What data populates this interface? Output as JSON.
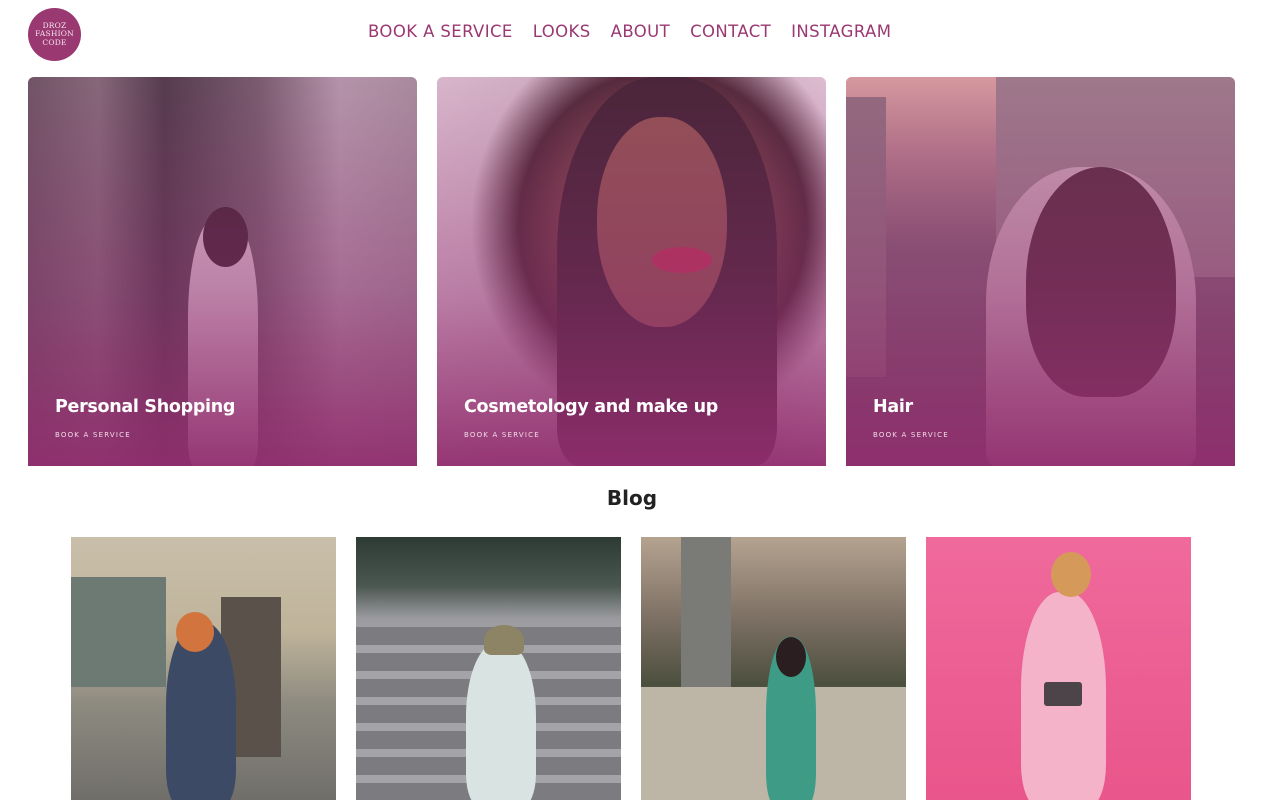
{
  "header": {
    "logo_lines": [
      "DROZ",
      "FASHION",
      "CODE"
    ],
    "nav": [
      "BOOK A SERVICE",
      "LOOKS",
      "ABOUT",
      "CONTACT",
      "INSTAGRAM"
    ]
  },
  "services": [
    {
      "title": "Personal Shopping",
      "cta": "BOOK A SERVICE"
    },
    {
      "title": "Cosmetology and make up",
      "cta": "BOOK A SERVICE"
    },
    {
      "title": "Hair",
      "cta": "BOOK A SERVICE"
    }
  ],
  "blog": {
    "heading": "Blog"
  },
  "colors": {
    "brand": "#9a3872",
    "overlay": "#962d6e",
    "heading": "#222222"
  }
}
